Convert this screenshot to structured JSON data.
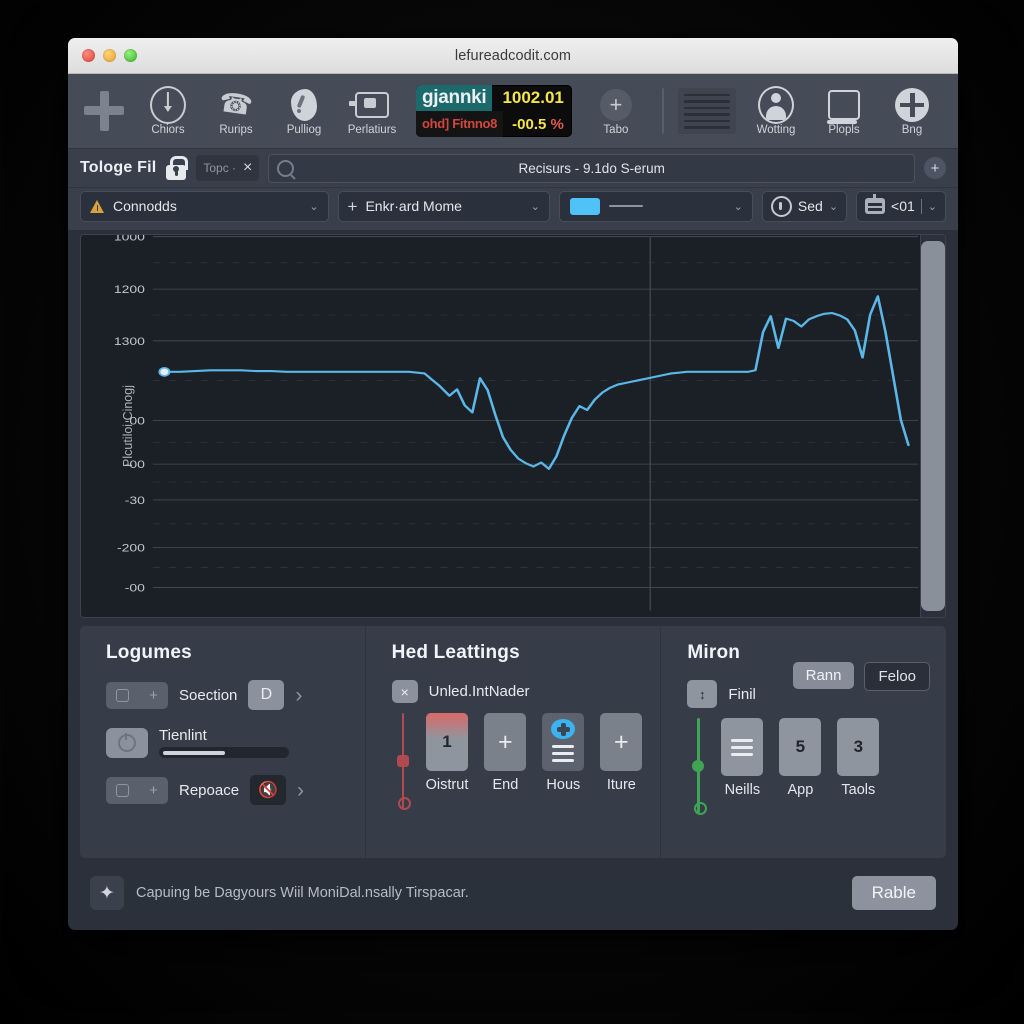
{
  "window": {
    "title": "lefureadcodit.com",
    "traffic_lights": [
      "close",
      "minimize",
      "zoom"
    ]
  },
  "toolbar": {
    "add_icon": "plus-icon",
    "items": [
      {
        "label": "Chiors",
        "icon": "clock-icon"
      },
      {
        "label": "Rurips",
        "icon": "phone-icon"
      },
      {
        "label": "Pulliog",
        "icon": "blob-icon"
      },
      {
        "label": "Perlatiurs",
        "icon": "screen-icon"
      }
    ],
    "ticker": {
      "symbol": "gjannki",
      "value": "1002.01",
      "sub_symbol": "ohd] Fitnno8",
      "change": "-00.5",
      "change_unit": "%",
      "value_color": "#f5e54a",
      "symbol_bg": "#1d6a6d",
      "sub_color": "#d1473f"
    },
    "tabo": {
      "label": "Tabo",
      "icon": "plus-circle-icon"
    },
    "right_items": [
      {
        "label": "Wotting",
        "icon": "person-circle-icon"
      },
      {
        "label": "Plopls",
        "icon": "monitor-icon"
      },
      {
        "label": "Bng",
        "icon": "plus-circle-filled-icon"
      }
    ]
  },
  "tabstrip": {
    "app_title": "Tologe Fil",
    "lock_icon": "lock-icon",
    "tab": {
      "label": "Topc ·",
      "close": "×"
    },
    "search": {
      "icon": "search-icon",
      "value": "Recisurs - 9.1do S-erum"
    },
    "add": "+"
  },
  "controls": {
    "instrument": {
      "label": "Connodds",
      "icon": "warning-triangle-icon",
      "caret": "⌄"
    },
    "indicator": {
      "label": "Enkr·ard Mome",
      "icon": "plus-icon",
      "caret": "⌄"
    },
    "style": {
      "swatch_color": "#4fc3f7",
      "line": "—",
      "caret": "⌄"
    },
    "sed": {
      "label": "Sed",
      "icon": "headphone-icon",
      "caret": "⌄"
    },
    "robot": {
      "label": "<01",
      "icon": "robot-icon",
      "caret": "⌄"
    }
  },
  "chart_data": {
    "type": "line",
    "title": "",
    "xlabel": "",
    "ylabel": "Plcutiloi Cinogj",
    "line_color": "#5bb7e8",
    "grid": true,
    "background": "#1b1f26",
    "ytick_labels": [
      "1000",
      "1200",
      "1300",
      "-00",
      "-00",
      "-30",
      "-200",
      "-00"
    ],
    "ytick_positions": [
      0,
      66,
      131,
      231,
      286,
      331,
      391,
      441
    ],
    "ylim": [
      0,
      470
    ],
    "xlim": [
      0,
      800
    ],
    "vertical_divider_x": 520,
    "marker_point": {
      "x": 12,
      "y": 170
    },
    "x": [
      12,
      28,
      44,
      60,
      76,
      92,
      108,
      124,
      140,
      156,
      172,
      188,
      204,
      220,
      236,
      252,
      268,
      284,
      300,
      310,
      318,
      326,
      334,
      342,
      350,
      358,
      366,
      374,
      382,
      390,
      398,
      406,
      414,
      422,
      430,
      438,
      446,
      454,
      462,
      470,
      478,
      486,
      494,
      502,
      510,
      518,
      526,
      534,
      542,
      550,
      558,
      566,
      574,
      582,
      590,
      598,
      606,
      614,
      622,
      630,
      638,
      646,
      654,
      662,
      670,
      678,
      686,
      694,
      702,
      710,
      718,
      726,
      734,
      742,
      750,
      758,
      766,
      774,
      782,
      790
    ],
    "y": [
      170,
      170,
      169,
      168,
      168,
      168,
      169,
      169,
      170,
      170,
      170,
      170,
      170,
      170,
      170,
      170,
      170,
      172,
      188,
      200,
      192,
      212,
      221,
      178,
      193,
      224,
      252,
      268,
      279,
      285,
      289,
      284,
      292,
      276,
      250,
      228,
      213,
      218,
      205,
      196,
      190,
      186,
      184,
      182,
      180,
      178,
      176,
      174,
      172,
      171,
      170,
      170,
      170,
      170,
      170,
      170,
      170,
      170,
      170,
      168,
      120,
      100,
      140,
      103,
      106,
      113,
      104,
      100,
      97,
      96,
      99,
      104,
      118,
      152,
      98,
      75,
      120,
      175,
      230,
      262
    ]
  },
  "panels": [
    {
      "title": "Logumes",
      "rows": [
        {
          "name": "Soection",
          "left_icon": "pentagon-plus-icon",
          "badge": "D",
          "chevron": "›"
        },
        {
          "name": "Tienlint",
          "left_icon": "knob-icon",
          "slider_value": 45
        },
        {
          "name": "Repoace",
          "left_icon": "pentagon-plus-icon",
          "badge": "mute-icon",
          "chevron": "›"
        }
      ]
    },
    {
      "title": "Hed Leattings",
      "subrow": {
        "close": "×",
        "label": "Unled.IntNader"
      },
      "slider_color": "#b04a4f",
      "tiles": [
        {
          "caption": "Oistrut",
          "value": "1",
          "style": "redtop"
        },
        {
          "caption": "End",
          "value": "+",
          "style": "plus"
        },
        {
          "caption": "Hous",
          "value": "hamburger-icon",
          "style": "dark2"
        },
        {
          "caption": "Iture",
          "value": "+",
          "style": "plus"
        }
      ]
    },
    {
      "title": "Miron",
      "subrow": {
        "label": "Finil",
        "icon": "updown-icon"
      },
      "buttons": [
        {
          "label": "Rann",
          "style": "solid"
        },
        {
          "label": "Feloo",
          "style": "ghost"
        }
      ],
      "slider_color": "#3fa552",
      "tiles": [
        {
          "caption": "Neills",
          "value": "hamburger-icon",
          "style": "plain"
        },
        {
          "caption": "App",
          "value": "5",
          "style": "plain"
        },
        {
          "caption": "Taols",
          "value": "3",
          "style": "plain"
        }
      ]
    }
  ],
  "footer": {
    "icon": "move-arrows-icon",
    "message": "Capuing be Dagyours Wiil MoniDal.nsally Tirspacar.",
    "button": "Rable"
  }
}
